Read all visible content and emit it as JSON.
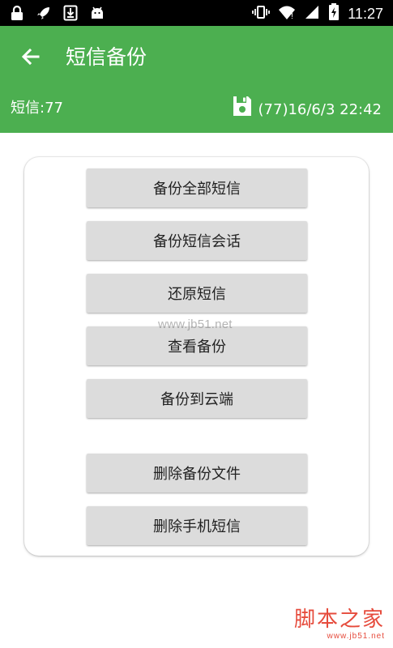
{
  "status_bar": {
    "time": "11:27",
    "left_icons": [
      "lock-icon",
      "rocket-icon",
      "download-icon",
      "android-icon"
    ],
    "right_icons": [
      "vibrate-icon",
      "wifi-icon",
      "signal-icon",
      "battery-charging-icon"
    ]
  },
  "app_bar": {
    "title": "短信备份",
    "sms_count": "短信:77",
    "backup_info": "(77)16/6/3 22:42",
    "color": "#4CAF50"
  },
  "actions": {
    "backup_all": "备份全部短信",
    "backup_threads": "备份短信会话",
    "restore": "还原短信",
    "view_backup": "查看备份",
    "backup_cloud": "备份到云端",
    "delete_backup_files": "删除备份文件",
    "delete_phone_sms": "删除手机短信"
  },
  "watermark": "www.jb51.net",
  "footer_logo": {
    "main": "脚本之家",
    "sub": "www.jb51.net"
  }
}
